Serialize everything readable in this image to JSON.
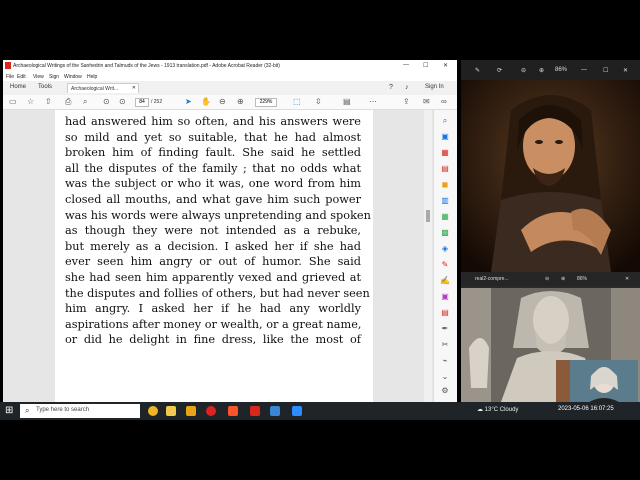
{
  "acrobat": {
    "window_title": "Archaeological Writings of the Sanhedrin and Talmuds of the Jews - 1913 translation.pdf - Adobe Acrobat Reader (32-bit)",
    "menu": [
      "File",
      "Edit",
      "View",
      "Sign",
      "Window",
      "Help"
    ],
    "tabs": {
      "home": "Home",
      "tools": "Tools",
      "doc": "Archaeological Writ..."
    },
    "sign_in": "Sign In",
    "page_current": "84",
    "page_total": "/ 252",
    "zoom": "229%",
    "text_lines": [
      "had answered him so often, and his answers were",
      "so mild and yet so suitable, that he had almost",
      "broken him of finding fault. She said he settled",
      "all the disputes of the family ; that no odds what",
      "was the subject or who it was, one word from him",
      "closed all mouths, and what gave him such power",
      "was his words were always unpretending and spoken",
      "as though they were not intended as a rebuke,",
      "but merely as a decision. I asked her if she had",
      "ever seen him angry or out of humor. She said",
      "she had seen him apparently vexed and grieved at",
      "the disputes and follies of others, but had never seen",
      "him angry. I asked her if he had any worldly",
      "aspirations after money or wealth, or a great name,",
      "or did he delight in fine dress, like the most of"
    ]
  },
  "viewer_top": {
    "zoom": "86%"
  },
  "viewer_bottom": {
    "filename": "real2-compre...",
    "zoom": "86%"
  },
  "taskbar": {
    "search_placeholder": "Type here to search",
    "weather": "13°C  Cloudy",
    "clock": "2023-05-06  16:07:25"
  },
  "colors": {
    "accent": "#1473e6",
    "taskbar": "#1f2428",
    "acrobat_red": "#d7281c"
  }
}
